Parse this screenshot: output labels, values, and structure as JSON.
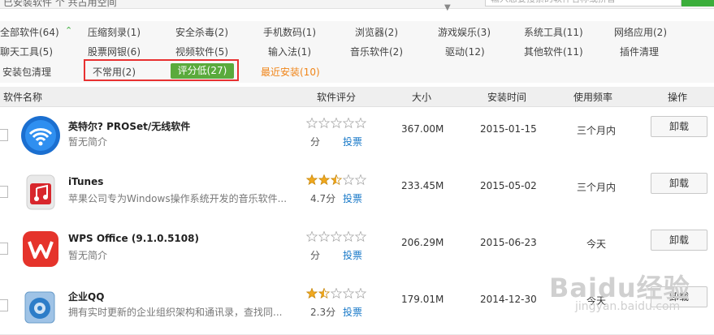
{
  "top": {
    "search_placeholder": "输入您要搜索的软件名称或拼音",
    "clipped_text": "已安装软件 个 共占用空间"
  },
  "categories": {
    "row1": [
      "全部软件(64)",
      "压缩刻录(1)",
      "安全杀毒(2)",
      "手机数码(1)",
      "浏览器(2)",
      "游戏娱乐(3)",
      "系统工具(11)",
      "网络应用(2)"
    ],
    "row2": [
      "聊天工具(5)",
      "股票网银(6)",
      "视频软件(5)",
      "输入法(1)",
      "音乐软件(2)",
      "驱动(12)",
      "其他软件(11)",
      "插件清理"
    ],
    "row3": [
      "安装包清理",
      "不常用(2)",
      "评分低(27)",
      "最近安装(10)"
    ]
  },
  "table": {
    "headers": [
      "软件名称",
      "软件评分",
      "大小",
      "安装时间",
      "使用频率",
      "操作"
    ],
    "rows": [
      {
        "name": "英特尔? PROSet/无线软件",
        "desc": "暂无简介",
        "rating": 0,
        "score": "分",
        "vote": "投票",
        "size": "367.00M",
        "date": "2015-01-15",
        "freq": "三个月内",
        "action": "卸载"
      },
      {
        "name": "iTunes",
        "desc": "苹果公司专为Windows操作系统开发的音乐软件...",
        "rating": 2.35,
        "score": "4.7分",
        "vote": "投票",
        "size": "233.45M",
        "date": "2015-05-02",
        "freq": "三个月内",
        "action": "卸载"
      },
      {
        "name": "WPS Office (9.1.0.5108)",
        "desc": "暂无简介",
        "rating": 0,
        "score": "分",
        "vote": "投票",
        "size": "206.29M",
        "date": "2015-06-23",
        "freq": "今天",
        "action": "卸载"
      },
      {
        "name": "企业QQ",
        "desc": "拥有实时更新的企业组织架构和通讯录，查找同...",
        "rating": 1.15,
        "score": "2.3分",
        "vote": "投票",
        "size": "179.01M",
        "date": "2014-12-30",
        "freq": "今天",
        "action": "卸载"
      }
    ]
  },
  "watermark": {
    "logo": "Baidu经验",
    "url": "jingyan.baidu.com"
  },
  "colors": {
    "accent_green": "#5aaa3c",
    "highlight_red": "#e83131",
    "recent_orange": "#f08519",
    "link_blue": "#1a7ac8",
    "star_gold": "#f0a81e"
  }
}
